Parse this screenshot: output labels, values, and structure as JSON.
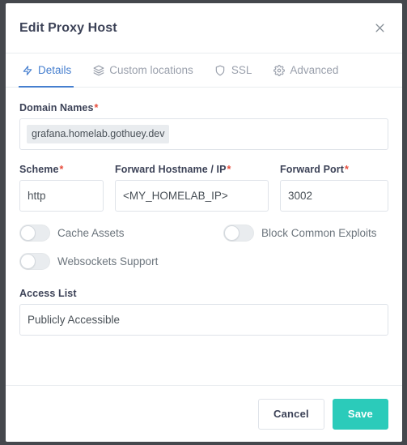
{
  "dialog": {
    "title": "Edit Proxy Host",
    "close_icon": "close-icon"
  },
  "tabs": [
    {
      "label": "Details",
      "icon": "bolt-icon",
      "active": true
    },
    {
      "label": "Custom locations",
      "icon": "layers-icon",
      "active": false
    },
    {
      "label": "SSL",
      "icon": "shield-icon",
      "active": false
    },
    {
      "label": "Advanced",
      "icon": "gear-icon",
      "active": false
    }
  ],
  "form": {
    "domain_names": {
      "label": "Domain Names",
      "required_marker": "*",
      "tags": [
        "grafana.homelab.gothuey.dev"
      ]
    },
    "scheme": {
      "label": "Scheme",
      "required_marker": "*",
      "value": "http"
    },
    "forward_hostname": {
      "label": "Forward Hostname / IP",
      "required_marker": "*",
      "value": "<MY_HOMELAB_IP>"
    },
    "forward_port": {
      "label": "Forward Port",
      "required_marker": "*",
      "value": "3002"
    },
    "toggles": [
      {
        "label": "Cache Assets",
        "on": false
      },
      {
        "label": "Block Common Exploits",
        "on": false
      },
      {
        "label": "Websockets Support",
        "on": false
      }
    ],
    "access_list": {
      "label": "Access List",
      "value": "Publicly Accessible"
    }
  },
  "footer": {
    "cancel_label": "Cancel",
    "save_label": "Save"
  },
  "colors": {
    "accent_blue": "#467fcf",
    "save_teal": "#2bcbba",
    "required_red": "#e74c3c",
    "muted_gray": "#9aa0ac"
  }
}
